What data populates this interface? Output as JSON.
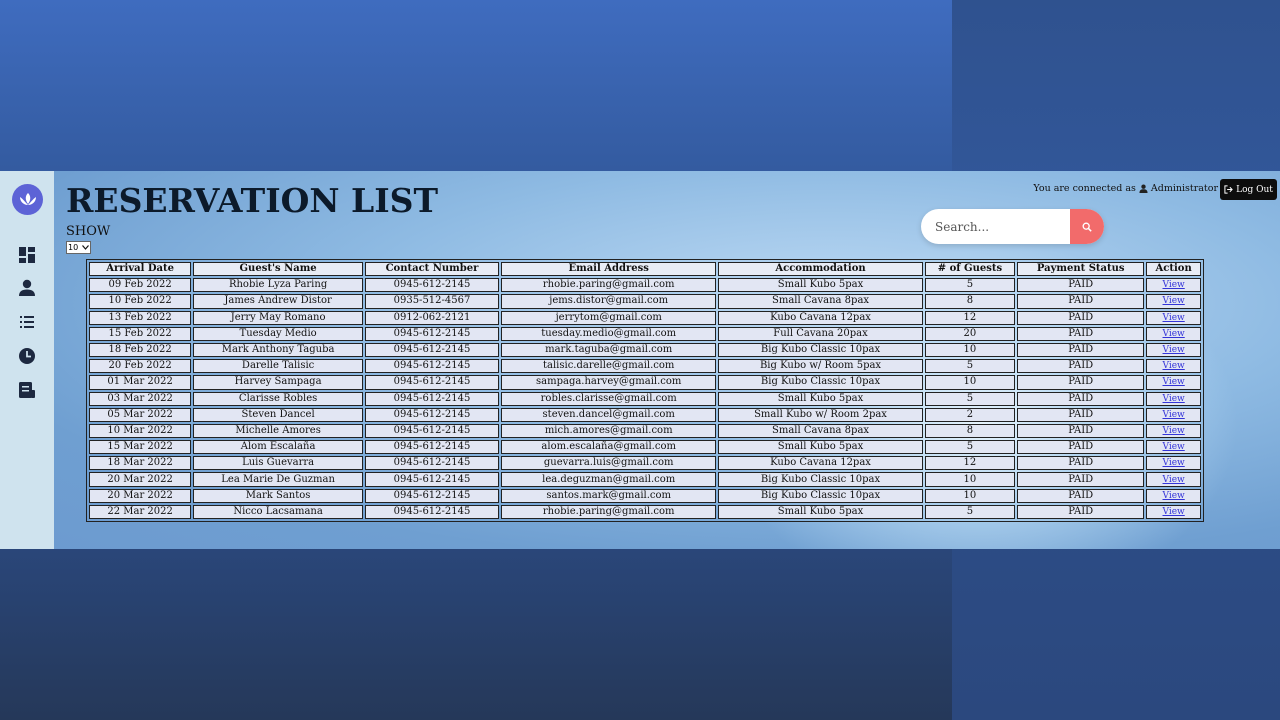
{
  "page": {
    "title": "RESERVATION LIST",
    "show_label": "SHOW",
    "show_value": "10"
  },
  "header": {
    "connected_text": "You are connected as",
    "user": "Administrator",
    "logout_label": "Log Out"
  },
  "search": {
    "placeholder": "Search..."
  },
  "sidebar": {
    "items": [
      {
        "icon": "dashboard-icon"
      },
      {
        "icon": "user-icon"
      },
      {
        "icon": "list-icon"
      },
      {
        "icon": "clock-icon"
      },
      {
        "icon": "report-icon"
      }
    ]
  },
  "colors": {
    "accent": "#5d63d6",
    "search_button": "#f26b6b",
    "logout_bg": "#0d0d0d"
  },
  "table": {
    "headers": [
      "Arrival Date",
      "Guest's Name",
      "Contact Number",
      "Email Address",
      "Accommodation",
      "# of Guests",
      "Payment Status",
      "Action"
    ],
    "rows": [
      [
        "09 Feb 2022",
        "Rhobie Lyza Paring",
        "0945-612-2145",
        "rhobie.paring@gmail.com",
        "Small Kubo 5pax",
        "5",
        "PAID",
        "View"
      ],
      [
        "10 Feb 2022",
        "James Andrew Distor",
        "0935-512-4567",
        "jems.distor@gmail.com",
        "Small Cavana 8pax",
        "8",
        "PAID",
        "View"
      ],
      [
        "13 Feb 2022",
        "Jerry May Romano",
        "0912-062-2121",
        "jerrytom@gmail.com",
        "Kubo Cavana 12pax",
        "12",
        "PAID",
        "View"
      ],
      [
        "15 Feb 2022",
        "Tuesday Medio",
        "0945-612-2145",
        "tuesday.medio@gmail.com",
        "Full Cavana 20pax",
        "20",
        "PAID",
        "View"
      ],
      [
        "18 Feb 2022",
        "Mark Anthony Taguba",
        "0945-612-2145",
        "mark.taguba@gmail.com",
        "Big Kubo Classic 10pax",
        "10",
        "PAID",
        "View"
      ],
      [
        "20 Feb 2022",
        "Darelle Talisic",
        "0945-612-2145",
        "talisic.darelle@gmail.com",
        "Big Kubo w/ Room 5pax",
        "5",
        "PAID",
        "View"
      ],
      [
        "01 Mar 2022",
        "Harvey Sampaga",
        "0945-612-2145",
        "sampaga.harvey@gmail.com",
        "Big Kubo Classic 10pax",
        "10",
        "PAID",
        "View"
      ],
      [
        "03 Mar 2022",
        "Clarisse Robles",
        "0945-612-2145",
        "robles.clarisse@gmail.com",
        "Small Kubo 5pax",
        "5",
        "PAID",
        "View"
      ],
      [
        "05 Mar 2022",
        "Steven Dancel",
        "0945-612-2145",
        "steven.dancel@gmail.com",
        "Small Kubo w/ Room 2pax",
        "2",
        "PAID",
        "View"
      ],
      [
        "10 Mar 2022",
        "Michelle Amores",
        "0945-612-2145",
        "mich.amores@gmail.com",
        "Small Cavana 8pax",
        "8",
        "PAID",
        "View"
      ],
      [
        "15 Mar 2022",
        "Alom Escalaña",
        "0945-612-2145",
        "alom.escalaña@gmail.com",
        "Small Kubo 5pax",
        "5",
        "PAID",
        "View"
      ],
      [
        "18 Mar 2022",
        "Luis Guevarra",
        "0945-612-2145",
        "guevarra.luis@gmail.com",
        "Kubo Cavana 12pax",
        "12",
        "PAID",
        "View"
      ],
      [
        "20 Mar 2022",
        "Lea Marie De Guzman",
        "0945-612-2145",
        "lea.deguzman@gmail.com",
        "Big Kubo Classic 10pax",
        "10",
        "PAID",
        "View"
      ],
      [
        "20 Mar 2022",
        "Mark Santos",
        "0945-612-2145",
        "santos.mark@gmail.com",
        "Big Kubo Classic 10pax",
        "10",
        "PAID",
        "View"
      ],
      [
        "22 Mar 2022",
        "Nicco Lacsamana",
        "0945-612-2145",
        "rhobie.paring@gmail.com",
        "Small Kubo 5pax",
        "5",
        "PAID",
        "View"
      ]
    ]
  }
}
